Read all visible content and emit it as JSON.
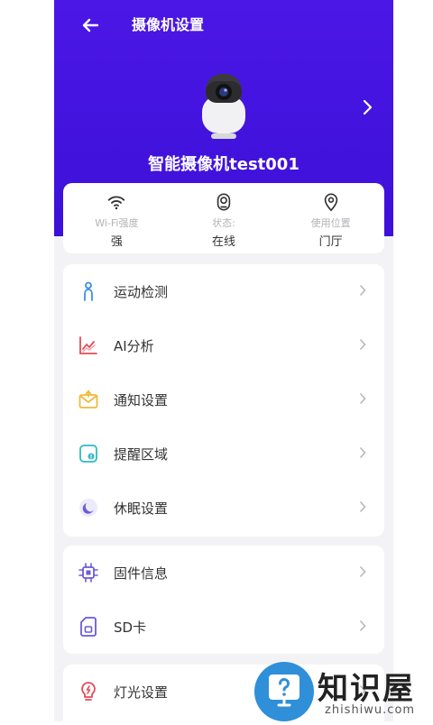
{
  "header": {
    "title": "摄像机设置",
    "camera_name": "智能摄像机test001"
  },
  "status": [
    {
      "icon": "wifi-icon",
      "label": "Wi-Fi强度",
      "value": "强"
    },
    {
      "icon": "camera-status-icon",
      "label": "状态:",
      "value": "在线"
    },
    {
      "icon": "location-icon",
      "label": "使用位置",
      "value": "门厅"
    }
  ],
  "menu": {
    "group1": [
      {
        "icon": "person-icon",
        "label": "运动检测"
      },
      {
        "icon": "chart-icon",
        "label": "AI分析"
      },
      {
        "icon": "mail-icon",
        "label": "通知设置"
      },
      {
        "icon": "area-icon",
        "label": "提醒区域"
      },
      {
        "icon": "moon-icon",
        "label": "休眠设置"
      }
    ],
    "group2": [
      {
        "icon": "chip-icon",
        "label": "固件信息"
      },
      {
        "icon": "sdcard-icon",
        "label": "SD卡"
      }
    ],
    "group3": [
      {
        "icon": "bulb-icon",
        "label": "灯光设置"
      }
    ]
  },
  "watermark": {
    "name": "知识屋",
    "domain": "zhishiwu.com"
  },
  "colors": {
    "header": "#4b17e6",
    "accent_purple": "#6b5bd6",
    "icon_blue": "#3d8fe0",
    "icon_red": "#e24c5a",
    "icon_yellow": "#f0b93a",
    "icon_teal": "#2fb9c7"
  }
}
